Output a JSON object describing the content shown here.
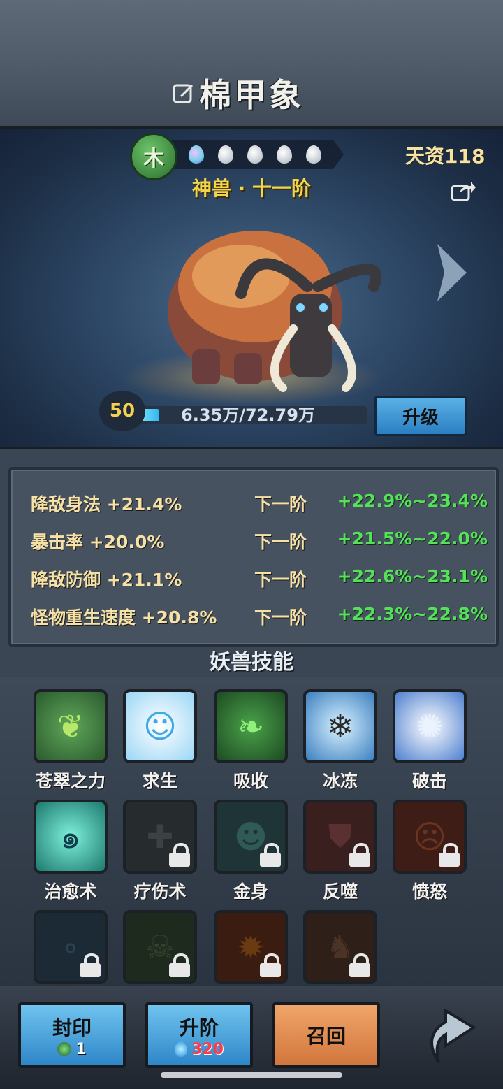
{
  "header": {
    "title": "棉甲象",
    "edit_icon": "edit-icon"
  },
  "beast": {
    "element": "木",
    "element_color": "#4ea84c",
    "drops_total": 5,
    "talent": "天资118",
    "rank": "神兽 · 十一阶",
    "level": "50",
    "exp_text": "6.35万/72.79万",
    "exp_fraction": 0.087,
    "upgrade_label": "升级"
  },
  "stats": {
    "rows": [
      {
        "name": "降敌身法 +21.4%",
        "next": "下一阶",
        "range": "+22.9%~23.4%"
      },
      {
        "name": "暴击率 +20.0%",
        "next": "下一阶",
        "range": "+21.5%~22.0%"
      },
      {
        "name": "降敌防御 +21.1%",
        "next": "下一阶",
        "range": "+22.6%~23.1%"
      },
      {
        "name": "怪物重生速度 +20.8%",
        "next": "下一阶",
        "range": "+22.3%~22.8%"
      }
    ],
    "range_color": "#55e25a"
  },
  "skills": {
    "title": "妖兽技能",
    "items": [
      {
        "label": "苍翠之力",
        "icon": "vine-icon",
        "locked": false
      },
      {
        "label": "求生",
        "icon": "spirit-icon",
        "locked": false
      },
      {
        "label": "吸收",
        "icon": "leaf-absorb-icon",
        "locked": false
      },
      {
        "label": "冰冻",
        "icon": "ice-icon",
        "locked": false
      },
      {
        "label": "破击",
        "icon": "shatter-icon",
        "locked": false
      },
      {
        "label": "治愈术",
        "icon": "heal-drop-icon",
        "locked": false
      },
      {
        "label": "疗伤术",
        "icon": "cross-icon",
        "locked": true
      },
      {
        "label": "金身",
        "icon": "golden-body-icon",
        "locked": true
      },
      {
        "label": "反噬",
        "icon": "shield-icon",
        "locked": true
      },
      {
        "label": "愤怒",
        "icon": "rage-icon",
        "locked": true
      },
      {
        "label": "",
        "icon": "bubble-icon",
        "locked": true
      },
      {
        "label": "",
        "icon": "skull-icon",
        "locked": true
      },
      {
        "label": "",
        "icon": "fire-icon",
        "locked": true
      },
      {
        "label": "",
        "icon": "beast-icon",
        "locked": true
      }
    ]
  },
  "bottom": {
    "seal": {
      "label": "封印",
      "count": "1"
    },
    "ascend": {
      "label": "升阶",
      "count": "320"
    },
    "recall": {
      "label": "召回"
    }
  }
}
